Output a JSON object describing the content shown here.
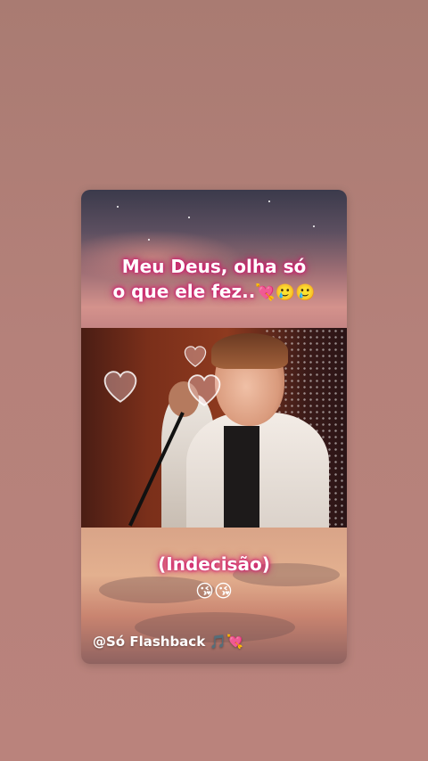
{
  "caption_top": {
    "line1": "Meu Deus,  olha só",
    "line2": "o que ele fez..",
    "emojis": "💘🥲🥲"
  },
  "caption_bottom": {
    "line1": "(Indecisão)",
    "emojis": "😘😘"
  },
  "watermark": {
    "text": "@Só Flashback",
    "emojis": "🎵💘"
  },
  "colors": {
    "caption_glow": "#d0186e",
    "page_background": "#b5817a"
  }
}
